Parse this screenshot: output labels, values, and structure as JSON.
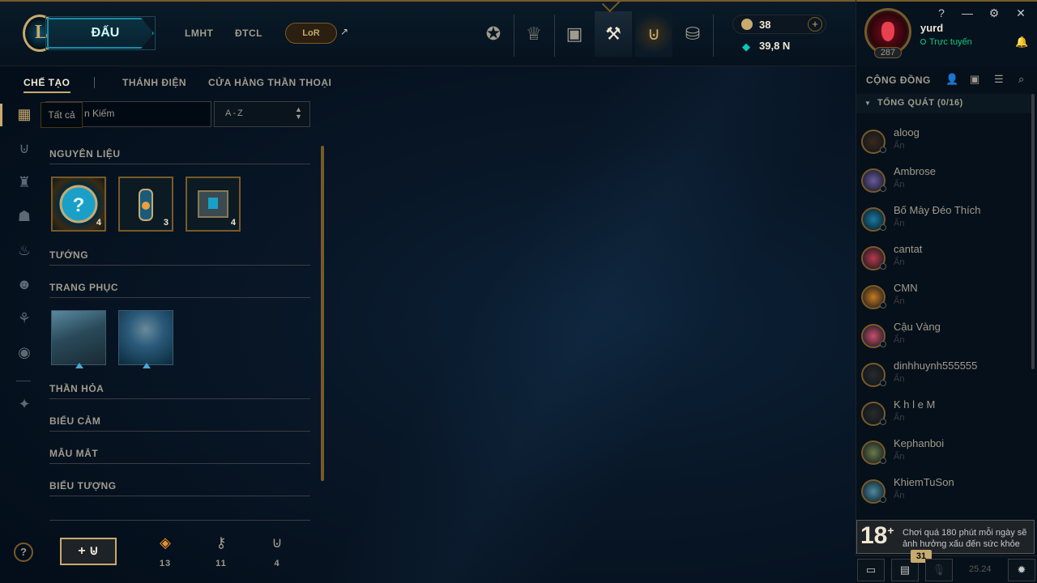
{
  "topbar": {
    "play_label": "ĐẤU",
    "nav": [
      "LMHT",
      "ĐTCL"
    ],
    "lor_label": "LoR",
    "ext_arrow": "↗",
    "rp": "38",
    "be": "39,8 N",
    "plus": "+"
  },
  "profile": {
    "name": "yurd",
    "status": "Trực tuyến",
    "level": "287"
  },
  "window": {
    "help": "?",
    "min": "—",
    "settings": "⚙",
    "close": "✕"
  },
  "subtabs": [
    "CHẾ TẠO",
    "THÁNH ĐIỆN",
    "CỬA HÀNG THẦN THOẠI"
  ],
  "filter": {
    "tooltip": "Tất cả",
    "search_text": "n Kiếm",
    "sort": "A-Z"
  },
  "sections": {
    "materials": "NGUYÊN LIỆU",
    "champions": "TƯỚNG",
    "skins": "TRANG PHỤC",
    "wards": "THẦN HỎA",
    "emotes": "BIỂU CẢM",
    "eyes": "MẪU MẮT",
    "icons": "BIỂU TƯỢNG"
  },
  "materials": [
    {
      "icon": "mystery-orb-icon",
      "count": "4"
    },
    {
      "icon": "key-fragment-capsule-icon",
      "count": "3"
    },
    {
      "icon": "chest-icon",
      "count": "4"
    }
  ],
  "bottom": {
    "help": "?",
    "add_label": "+",
    "resources": [
      {
        "icon": "orange-essence-icon",
        "value": "13"
      },
      {
        "icon": "key-icon",
        "value": "11"
      },
      {
        "icon": "chest-icon",
        "value": "4"
      }
    ]
  },
  "social": {
    "title": "CỘNG ĐỒNG",
    "group": "TỔNG QUÁT (0/16)",
    "friends": [
      {
        "name": "aloog",
        "status": "Ẩn",
        "color": "#3a2a1a"
      },
      {
        "name": "Ambrose",
        "status": "Ẩn",
        "color": "#6a5a9a"
      },
      {
        "name": "Bố Mày Đéo Thích",
        "status": "Ẩn",
        "color": "#1a7aa0"
      },
      {
        "name": "cantat",
        "status": "Ẩn",
        "color": "#b83a4a"
      },
      {
        "name": "CMN",
        "status": "Ẩn",
        "color": "#c87a20"
      },
      {
        "name": "Cậu Vàng",
        "status": "Ẩn",
        "color": "#c8506a"
      },
      {
        "name": "dinhhuynh555555",
        "status": "Ẩn",
        "color": "#2a2a2a"
      },
      {
        "name": "K h l e M",
        "status": "Ẩn",
        "color": "#2a2a2a"
      },
      {
        "name": "Kephanboi",
        "status": "Ẩn",
        "color": "#6a7a4a"
      },
      {
        "name": "KhiemTuSon",
        "status": "Ẩn",
        "color": "#4a8aa0"
      }
    ],
    "age_rating": "18",
    "age_plus": "+",
    "age_warning": "Chơi quá 180 phút mỗi ngày sẽ ảnh hưởng xấu đến sức khỏe",
    "badge": "31",
    "version": "25.24"
  }
}
